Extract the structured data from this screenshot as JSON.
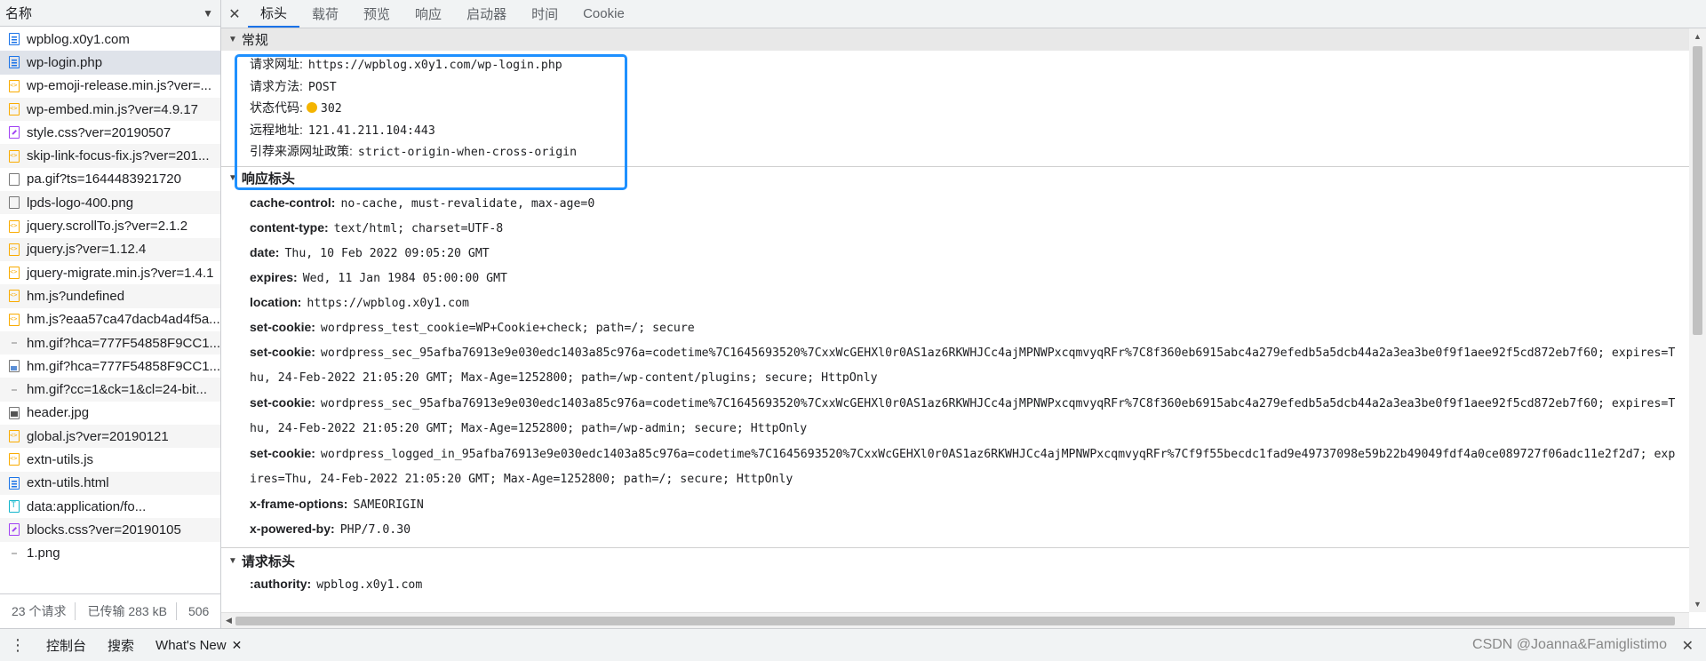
{
  "left_panel": {
    "header": "名称",
    "files": [
      {
        "name": "wpblog.x0y1.com",
        "icon": "doc-icon",
        "selected": false
      },
      {
        "name": "wp-login.php",
        "icon": "doc-icon",
        "selected": true
      },
      {
        "name": "wp-emoji-release.min.js?ver=...",
        "icon": "js-icon",
        "selected": false
      },
      {
        "name": "wp-embed.min.js?ver=4.9.17",
        "icon": "js-icon",
        "selected": false
      },
      {
        "name": "style.css?ver=20190507",
        "icon": "css-icon",
        "selected": false
      },
      {
        "name": "skip-link-focus-fix.js?ver=201...",
        "icon": "js-icon",
        "selected": false
      },
      {
        "name": "pa.gif?ts=1644483921720",
        "icon": "blank-icon",
        "selected": false
      },
      {
        "name": "lpds-logo-400.png",
        "icon": "blank-icon",
        "selected": false
      },
      {
        "name": "jquery.scrollTo.js?ver=2.1.2",
        "icon": "js-icon",
        "selected": false
      },
      {
        "name": "jquery.js?ver=1.12.4",
        "icon": "js-icon",
        "selected": false
      },
      {
        "name": "jquery-migrate.min.js?ver=1.4.1",
        "icon": "js-icon",
        "selected": false
      },
      {
        "name": "hm.js?undefined",
        "icon": "js-icon",
        "selected": false
      },
      {
        "name": "hm.js?eaa57ca47dacb4ad4f5a...",
        "icon": "js-icon",
        "selected": false
      },
      {
        "name": "hm.gif?hca=777F54858F9CC1...",
        "icon": "dot-icon",
        "selected": false
      },
      {
        "name": "hm.gif?hca=777F54858F9CC1...",
        "icon": "image-icon",
        "selected": false
      },
      {
        "name": "hm.gif?cc=1&ck=1&cl=24-bit...",
        "icon": "dot-icon",
        "selected": false
      },
      {
        "name": "header.jpg",
        "icon": "photo-icon",
        "selected": false
      },
      {
        "name": "global.js?ver=20190121",
        "icon": "js-icon",
        "selected": false
      },
      {
        "name": "extn-utils.js",
        "icon": "js-icon",
        "selected": false
      },
      {
        "name": "extn-utils.html",
        "icon": "doc-icon",
        "selected": false
      },
      {
        "name": "data:application/fo...",
        "icon": "text-icon",
        "selected": false
      },
      {
        "name": "blocks.css?ver=20190105",
        "icon": "css-icon",
        "selected": false
      },
      {
        "name": "1.png",
        "icon": "dot-icon",
        "selected": false
      }
    ],
    "status": {
      "requests": "23 个请求",
      "transferred": "已传输 283 kB",
      "resources": "506"
    }
  },
  "tabs": [
    "标头",
    "载荷",
    "预览",
    "响应",
    "启动器",
    "时间",
    "Cookie"
  ],
  "active_tab": "标头",
  "general": {
    "title": "常规",
    "rows": [
      {
        "key": "请求网址:",
        "value": "https://wpblog.x0y1.com/wp-login.php"
      },
      {
        "key": "请求方法:",
        "value": "POST"
      },
      {
        "key": "状态代码:",
        "value": "302"
      },
      {
        "key": "远程地址:",
        "value": "121.41.211.104:443"
      },
      {
        "key": "引荐来源网址政策:",
        "value": "strict-origin-when-cross-origin"
      }
    ]
  },
  "response_headers": {
    "title": "响应标头",
    "rows": [
      {
        "key": "cache-control:",
        "value": "no-cache, must-revalidate, max-age=0"
      },
      {
        "key": "content-type:",
        "value": "text/html; charset=UTF-8"
      },
      {
        "key": "date:",
        "value": "Thu, 10 Feb 2022 09:05:20 GMT"
      },
      {
        "key": "expires:",
        "value": "Wed, 11 Jan 1984 05:00:00 GMT"
      },
      {
        "key": "location:",
        "value": "https://wpblog.x0y1.com"
      },
      {
        "key": "set-cookie:",
        "value": "wordpress_test_cookie=WP+Cookie+check; path=/; secure"
      },
      {
        "key": "set-cookie:",
        "value": "wordpress_sec_95afba76913e9e030edc1403a85c976a=codetime%7C1645693520%7CxxWcGEHXl0r0AS1az6RKWHJCc4ajMPNWPxcqmvyqRFr%7C8f360eb6915abc4a279efedb5a5dcb44a2a3ea3be0f9f1aee92f5cd872eb7f60; expires=Thu, 24-Feb-2022 21:05:20 GMT; Max-Age=1252800; path=/wp-content/plugins; secure; HttpOnly"
      },
      {
        "key": "set-cookie:",
        "value": "wordpress_sec_95afba76913e9e030edc1403a85c976a=codetime%7C1645693520%7CxxWcGEHXl0r0AS1az6RKWHJCc4ajMPNWPxcqmvyqRFr%7C8f360eb6915abc4a279efedb5a5dcb44a2a3ea3be0f9f1aee92f5cd872eb7f60; expires=Thu, 24-Feb-2022 21:05:20 GMT; Max-Age=1252800; path=/wp-admin; secure; HttpOnly"
      },
      {
        "key": "set-cookie:",
        "value": "wordpress_logged_in_95afba76913e9e030edc1403a85c976a=codetime%7C1645693520%7CxxWcGEHXl0r0AS1az6RKWHJCc4ajMPNWPxcqmvyqRFr%7Cf9f55becdc1fad9e49737098e59b22b49049fdf4a0ce089727f06adc11e2f2d7; expires=Thu, 24-Feb-2022 21:05:20 GMT; Max-Age=1252800; path=/; secure; HttpOnly"
      },
      {
        "key": "x-frame-options:",
        "value": "SAMEORIGIN"
      },
      {
        "key": "x-powered-by:",
        "value": "PHP/7.0.30"
      }
    ]
  },
  "request_headers": {
    "title": "请求标头",
    "rows": [
      {
        "key": ":authority:",
        "value": "wpblog.x0y1.com"
      }
    ]
  },
  "drawer": {
    "tabs": [
      "控制台",
      "搜索",
      "What's New"
    ],
    "watermark": "CSDN @Joanna&Famiglistimo"
  },
  "colors": {
    "highlight_box": "#1e90ff",
    "status_dot": "#f4b400",
    "tab_active": "#1a73e8"
  }
}
